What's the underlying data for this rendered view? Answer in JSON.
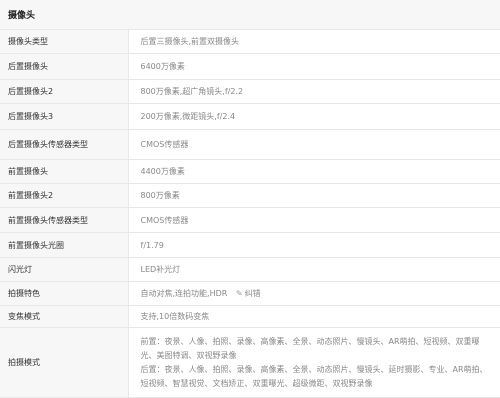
{
  "section_title": "摄像头",
  "rows": [
    {
      "label": "摄像头类型",
      "value": "后置三摄像头,前置双摄像头"
    },
    {
      "label": "后置摄像头",
      "value": "6400万像素"
    },
    {
      "label": "后置摄像头2",
      "value": "800万像素,超广角镜头,f/2.2"
    },
    {
      "label": "后置摄像头3",
      "value": "200万像素,微距镜头,f/2.4"
    },
    {
      "label": "后置摄像头传感器类型",
      "value": "CMOS传感器"
    },
    {
      "label": "前置摄像头",
      "value": "4400万像素"
    },
    {
      "label": "前置摄像头2",
      "value": "800万像素"
    },
    {
      "label": "前置摄像头传感器类型",
      "value": "CMOS传感器"
    },
    {
      "label": "前置摄像头光圈",
      "value": "f/1.79"
    },
    {
      "label": "闪光灯",
      "value": "LED补光灯"
    },
    {
      "label": "拍摄特色",
      "value": "自动对焦,连拍功能,HDR",
      "link": "纠错"
    },
    {
      "label": "变焦模式",
      "value": "支持,10倍数码变焦"
    },
    {
      "label": "拍摄模式",
      "value": "前置：夜景、人像、拍照、录像、高像素、全景、动态照片、慢镜头、AR萌拍、短视频、双重曝光、美图特调、双视野录像",
      "value2": "后置：夜景、人像、拍照、录像、高像素、全景、动态照片、慢镜头、延时摄影、专业、AR萌拍、短视频、智慧视觉、文档矫正、双重曝光、超级微距、双视野录像"
    }
  ]
}
